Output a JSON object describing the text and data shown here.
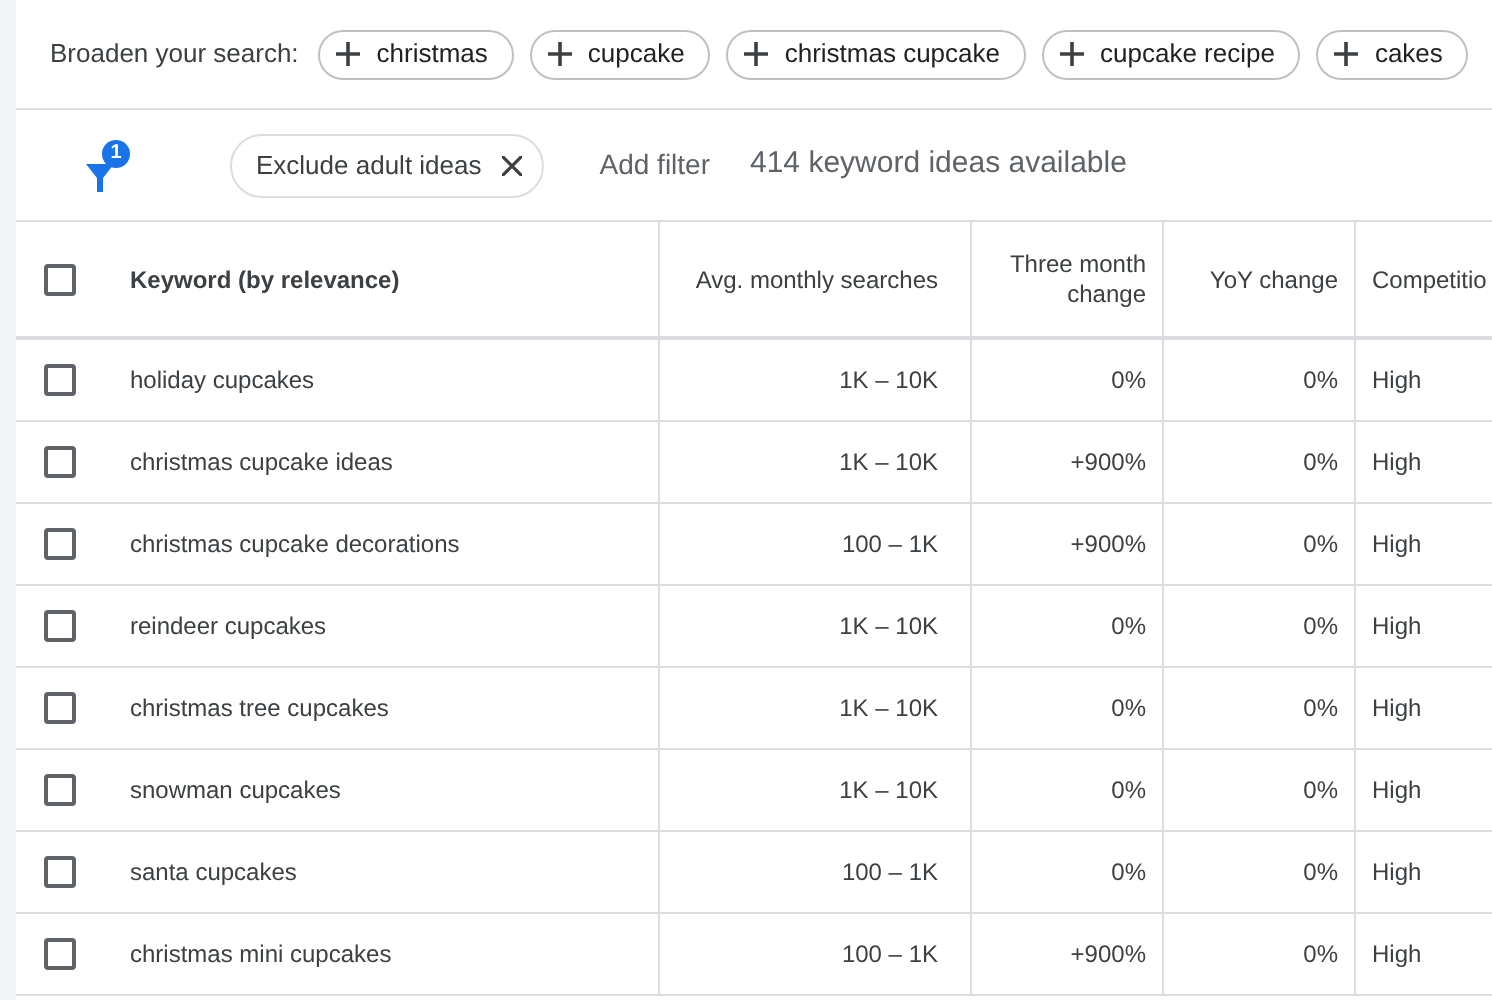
{
  "broaden": {
    "label": "Broaden your search:",
    "chips": [
      "christmas",
      "cupcake",
      "christmas cupcake",
      "cupcake recipe",
      "cakes"
    ]
  },
  "filter_bar": {
    "filter_count": "1",
    "filter_chip": "Exclude adult ideas",
    "add_filter": "Add filter",
    "summary": "414 keyword ideas available"
  },
  "table": {
    "select_all_checked": false,
    "columns": [
      "Keyword (by relevance)",
      "Avg. monthly searches",
      "Three month change",
      "YoY change",
      "Competitio"
    ],
    "rows": [
      {
        "checked": false,
        "cells": [
          "holiday cupcakes",
          "1K – 10K",
          "0%",
          "0%",
          "High"
        ]
      },
      {
        "checked": false,
        "cells": [
          "christmas cupcake ideas",
          "1K – 10K",
          "+900%",
          "0%",
          "High"
        ]
      },
      {
        "checked": false,
        "cells": [
          "christmas cupcake decorations",
          "100 – 1K",
          "+900%",
          "0%",
          "High"
        ]
      },
      {
        "checked": false,
        "cells": [
          "reindeer cupcakes",
          "1K – 10K",
          "0%",
          "0%",
          "High"
        ]
      },
      {
        "checked": false,
        "cells": [
          "christmas tree cupcakes",
          "1K – 10K",
          "0%",
          "0%",
          "High"
        ]
      },
      {
        "checked": false,
        "cells": [
          "snowman cupcakes",
          "1K – 10K",
          "0%",
          "0%",
          "High"
        ]
      },
      {
        "checked": false,
        "cells": [
          "santa cupcakes",
          "100 – 1K",
          "0%",
          "0%",
          "High"
        ]
      },
      {
        "checked": false,
        "cells": [
          "christmas mini cupcakes",
          "100 – 1K",
          "+900%",
          "0%",
          "High"
        ]
      }
    ]
  }
}
